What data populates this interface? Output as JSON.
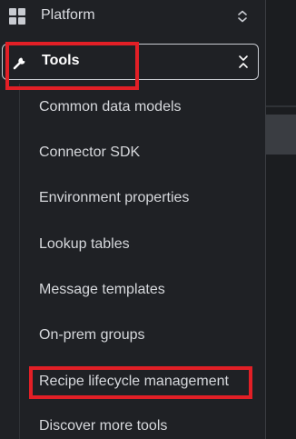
{
  "sidebar": {
    "platform": {
      "label": "Platform",
      "icon": "grid-icon",
      "chevron": "chevron-up-down-icon"
    },
    "tools": {
      "label": "Tools",
      "icon": "wrench-icon",
      "chevron": "chevron-collapse-icon",
      "expanded": true
    },
    "tools_items": [
      {
        "label": "Common data models"
      },
      {
        "label": "Connector SDK"
      },
      {
        "label": "Environment properties"
      },
      {
        "label": "Lookup tables"
      },
      {
        "label": "Message templates"
      },
      {
        "label": "On-prem groups"
      },
      {
        "label": "Recipe lifecycle management"
      },
      {
        "label": "Discover more tools"
      }
    ]
  },
  "annotations": {
    "highlight_color": "#e21f26",
    "highlighted": [
      "Tools",
      "Recipe lifecycle management"
    ]
  },
  "colors": {
    "background": "#1f2125",
    "text": "#d6d8dc",
    "active_text": "#ffffff",
    "active_border": "#c9ccd2"
  }
}
